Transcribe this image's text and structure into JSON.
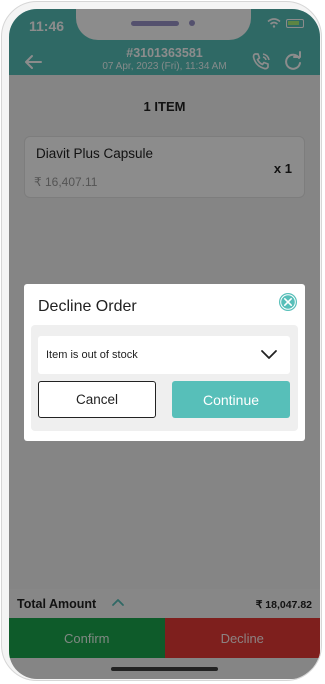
{
  "status_bar": {
    "time": "11:46"
  },
  "header": {
    "order_id": "#3101363581",
    "order_date": "07 Apr, 2023 (Fri),  11:34 AM",
    "icons": [
      "back-arrow-icon",
      "phone-call-icon",
      "refresh-icon"
    ]
  },
  "items_heading": "1 ITEM",
  "items": [
    {
      "name": "Diavit Plus Capsule",
      "price": "₹ 16,407.11",
      "qty": "x 1"
    }
  ],
  "footer": {
    "total_label": "Total Amount",
    "total_value": "₹ 18,047.82",
    "confirm_label": "Confirm",
    "decline_label": "Decline"
  },
  "modal": {
    "title": "Decline Order",
    "reason_selected": "Item is out of stock",
    "cancel_label": "Cancel",
    "continue_label": "Continue"
  },
  "colors": {
    "accent": "#57bfb9",
    "confirm": "#1aa64d",
    "decline": "#e53935"
  }
}
